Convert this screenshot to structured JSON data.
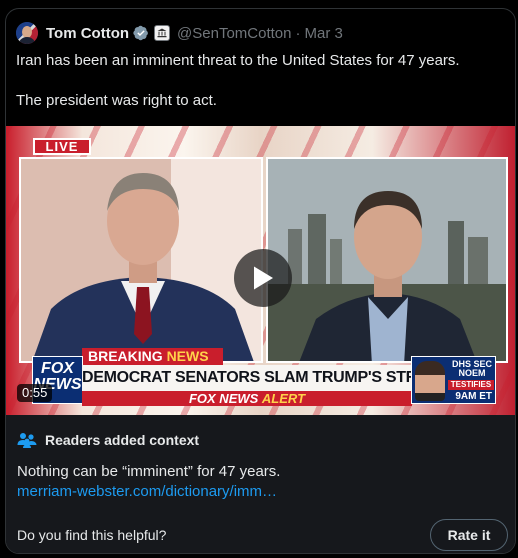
{
  "author": {
    "name": "Tom Cotton",
    "handle": "@SenTomCotton",
    "separator": "·",
    "date": "Mar 3"
  },
  "tweet": {
    "line1": "Iran has been an imminent threat to the United States for 47 years.",
    "line2": "The president was right to act."
  },
  "video": {
    "live_label": "LIVE",
    "breaking_prefix": "BREAKING ",
    "breaking_suffix": "NEWS",
    "network_logo": "FOX NEWS",
    "headline": "DEMOCRAT SENATORS SLAM TRUMP'S STRIKES IN IRAN",
    "alert_prefix": "FOX NEWS ",
    "alert_suffix": "ALERT",
    "promo_title": "DHS SEC NOEM",
    "promo_tag": "TESTIFIES",
    "promo_time": "9AM ET",
    "duration": "0:55"
  },
  "context": {
    "title": "Readers added context",
    "body": "Nothing can be “imminent” for 47 years.",
    "link": "merriam-webster.com/dictionary/imm…",
    "helpful_prompt": "Do you find this helpful?",
    "rate_label": "Rate it"
  },
  "colors": {
    "accent_link": "#1d9bf0",
    "verified": "#829aab",
    "fox_red": "#c91e2c",
    "fox_blue": "#0b2e73"
  },
  "icons": {
    "verified": "verified-badge-icon",
    "affiliation": "government-affiliation-icon",
    "play": "play-icon",
    "readers": "readers-context-icon"
  }
}
